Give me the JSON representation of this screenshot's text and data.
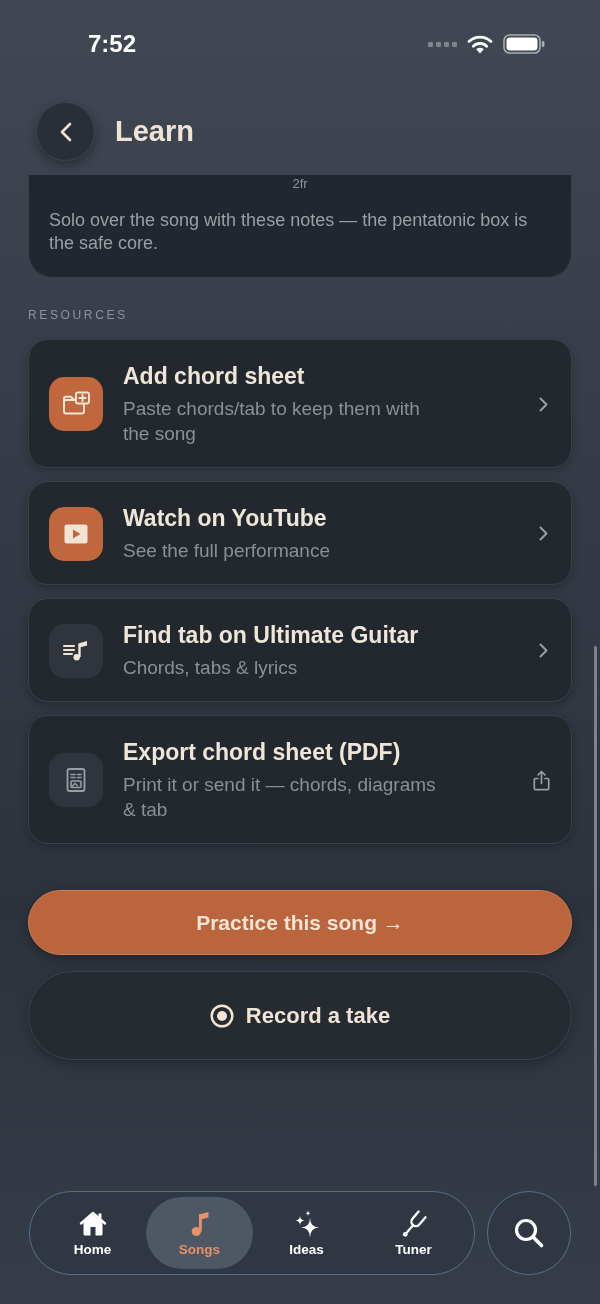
{
  "status_bar": {
    "time": "7:52"
  },
  "header": {
    "title": "Learn"
  },
  "scale_card": {
    "fret_label": "2fr",
    "description": "Solo over the song with these notes — the pentatonic box is the safe core."
  },
  "resources": {
    "heading": "RESOURCES",
    "items": [
      {
        "kind": "add",
        "title": "Add chord sheet",
        "subtitle": "Paste chords/tab to keep them with the song",
        "color": "#c0673e"
      },
      {
        "kind": "video",
        "title": "Watch on YouTube",
        "subtitle": "See the full performance",
        "color": "#c0673e"
      },
      {
        "kind": "tab",
        "title": "Find tab on Ultimate Guitar",
        "subtitle": "Chords, tabs & lyrics",
        "color": "#30353d"
      },
      {
        "kind": "export",
        "title": "Export chord sheet (PDF)",
        "subtitle": "Print it or send it — chords, diagrams & tab",
        "color": "#30353d"
      }
    ]
  },
  "actions": [
    {
      "kind": "primary",
      "label": "Practice this song →"
    },
    {
      "kind": "record",
      "label": "Record a take"
    }
  ],
  "tab_bar": {
    "tabs": [
      {
        "kind": "home",
        "label": "Home",
        "selected": false
      },
      {
        "kind": "songs",
        "label": "Songs",
        "selected": true
      },
      {
        "kind": "ideas",
        "label": "Ideas",
        "selected": false
      },
      {
        "kind": "tuner",
        "label": "Tuner",
        "selected": false
      }
    ]
  }
}
